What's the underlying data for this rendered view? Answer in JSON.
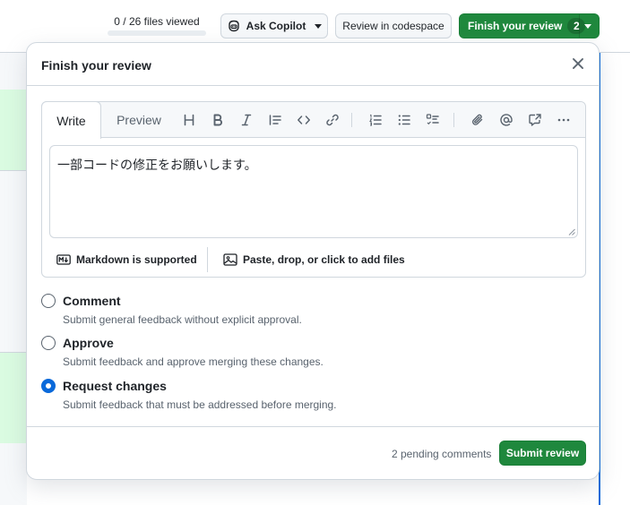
{
  "toolbar": {
    "files_viewed": "0 / 26 files viewed",
    "files_viewed_progress": 0,
    "ask_copilot_label": "Ask Copilot",
    "review_codespace_label": "Review in codespace",
    "finish_review_label": "Finish your review",
    "finish_review_count": "2"
  },
  "popover": {
    "title": "Finish your review",
    "editor": {
      "tabs": [
        "Write",
        "Preview"
      ],
      "active_tab": "Write",
      "toolbar_icons": [
        "heading-icon",
        "bold-icon",
        "italic-icon",
        "quote-icon",
        "code-icon",
        "link-icon",
        "numbered-list-icon",
        "unordered-list-icon",
        "task-list-icon",
        "attach-icon",
        "mention-icon",
        "cross-reference-icon",
        "more-icon"
      ],
      "body_text": "一部コードの修正をお願いします。",
      "markdown_note": "Markdown is supported",
      "attach_note": "Paste, drop, or click to add files"
    },
    "options": [
      {
        "label": "Comment",
        "description": "Submit general feedback without explicit approval.",
        "checked": false
      },
      {
        "label": "Approve",
        "description": "Submit feedback and approve merging these changes.",
        "checked": false
      },
      {
        "label": "Request changes",
        "description": "Submit feedback that must be addressed before merging.",
        "checked": true
      }
    ],
    "pending_comments": "2 pending comments",
    "submit_label": "Submit review"
  },
  "colors": {
    "primary_green": "#1f883d",
    "accent_blue": "#0969da",
    "diff_added_bg": "#dafbe1"
  }
}
